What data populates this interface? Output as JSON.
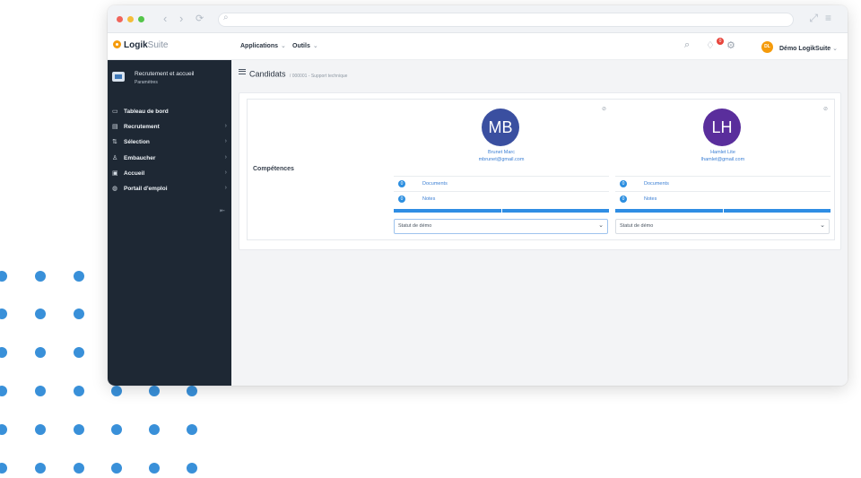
{
  "window": {
    "url": ""
  },
  "topbar": {
    "logo_bold": "Logik",
    "logo_light": "Suite",
    "menu": [
      {
        "label": "Applications"
      },
      {
        "label": "Outils"
      }
    ],
    "notification_count": "0",
    "user_initials": "DL",
    "user_name": "Démo LogikSuite"
  },
  "sidebar": {
    "module_title": "Recrutement et accueil",
    "module_subtitle": "Paramètres",
    "items": [
      {
        "label": "Tableau de bord",
        "icon": "monitor-icon",
        "has_arrow": false
      },
      {
        "label": "Recrutement",
        "icon": "document-icon",
        "has_arrow": true
      },
      {
        "label": "Sélection",
        "icon": "sort-icon",
        "has_arrow": true
      },
      {
        "label": "Embaucher",
        "icon": "user-icon",
        "has_arrow": true
      },
      {
        "label": "Accueil",
        "icon": "id-card-icon",
        "has_arrow": true
      },
      {
        "label": "Portail d'emploi",
        "icon": "globe-icon",
        "has_arrow": true
      }
    ]
  },
  "main": {
    "page_title": "Candidats",
    "breadcrumb_sub": "000001 - Support technique",
    "competences_label": "Compétences",
    "candidates": [
      {
        "initials": "MB",
        "name": "Brunet Marc",
        "email": "mbrunet@gmail.com",
        "color": "#3a4fa0",
        "documents_count": "0",
        "documents_label": "Documents",
        "notes_count": "0",
        "notes_label": "Notes",
        "status_value": "Statut de démo"
      },
      {
        "initials": "LH",
        "name": "Hamlet Lite",
        "email": "lhamlet@gmail.com",
        "color": "#5a2e9c",
        "documents_count": "0",
        "documents_label": "Documents",
        "notes_count": "0",
        "notes_label": "Notes",
        "status_value": "Statut de démo"
      }
    ]
  },
  "colors": {
    "accent": "#2f8de4",
    "sidebar_bg": "#1e2834",
    "dots": "#2e8cd6",
    "logo": "#f59b0b"
  }
}
